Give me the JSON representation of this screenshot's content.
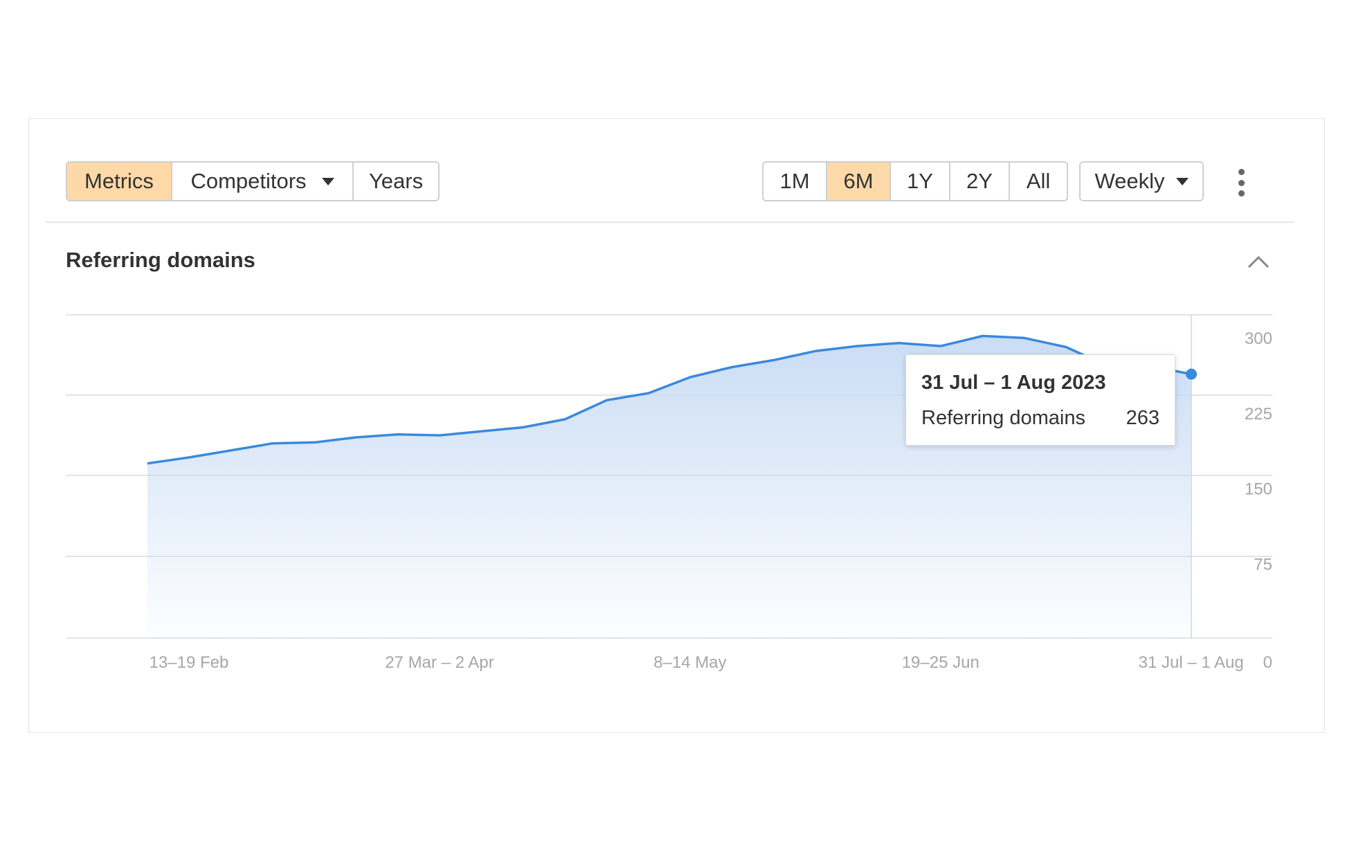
{
  "toolbar": {
    "view_tabs": [
      {
        "label": "Metrics",
        "active": true
      },
      {
        "label": "Competitors",
        "dropdown": true
      },
      {
        "label": "Years"
      }
    ],
    "range_tabs": [
      {
        "label": "1M"
      },
      {
        "label": "6M",
        "active": true
      },
      {
        "label": "1Y"
      },
      {
        "label": "2Y"
      },
      {
        "label": "All"
      }
    ],
    "interval_select": "Weekly",
    "more_icon": "kebab-vertical-icon",
    "active_color": "#fdd9a8"
  },
  "section": {
    "title": "Referring domains",
    "collapse_icon": "chevron-up-icon"
  },
  "tooltip": {
    "title": "31 Jul – 1 Aug 2023",
    "metric_label": "Referring domains",
    "metric_value": "263"
  },
  "chart_data": {
    "type": "area",
    "x_tick_labels": [
      "13–19 Feb",
      "27 Mar – 2 Apr",
      "8–14 May",
      "19–25 Jun",
      "31 Jul – 1 Aug"
    ],
    "x_tick_indices": [
      0,
      6,
      12,
      18,
      24
    ],
    "y_ticks": [
      0,
      75,
      150,
      225,
      300
    ],
    "ylim": [
      0,
      300
    ],
    "grid": true,
    "line_color": "#3b89dc",
    "fill_color": "#c9dcf4",
    "series": [
      {
        "name": "Referring domains",
        "values": [
          174,
          180,
          187,
          194,
          195,
          200,
          203,
          202,
          206,
          210,
          218,
          237,
          244,
          260,
          270,
          277,
          286,
          291,
          294,
          291,
          301,
          299,
          290,
          271,
          271,
          263
        ]
      }
    ],
    "highlight_index": 25
  }
}
